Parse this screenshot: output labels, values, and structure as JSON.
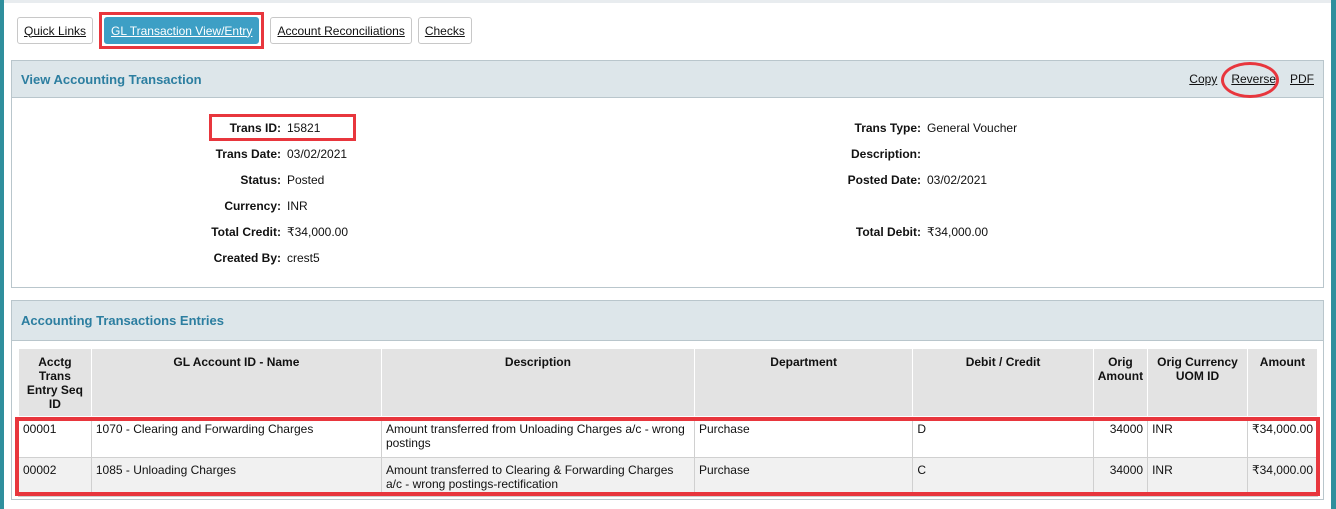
{
  "tabs": [
    {
      "label": "Quick Links"
    },
    {
      "label": "GL Transaction View/Entry"
    },
    {
      "label": "Account Reconciliations"
    },
    {
      "label": "Checks"
    }
  ],
  "view_panel": {
    "title": "View Accounting Transaction",
    "actions": {
      "copy": "Copy",
      "reverse": "Reverse",
      "pdf": "PDF"
    },
    "fields": {
      "trans_id": {
        "label": "Trans ID:",
        "value": "15821"
      },
      "trans_date": {
        "label": "Trans Date:",
        "value": "03/02/2021"
      },
      "status": {
        "label": "Status:",
        "value": "Posted"
      },
      "currency": {
        "label": "Currency:",
        "value": "INR"
      },
      "total_credit": {
        "label": "Total Credit:",
        "value": "₹34,000.00"
      },
      "created_by": {
        "label": "Created By:",
        "value": "crest5"
      },
      "trans_type": {
        "label": "Trans Type:",
        "value": "General Voucher"
      },
      "description": {
        "label": "Description:",
        "value": ""
      },
      "posted_date": {
        "label": "Posted Date:",
        "value": "03/02/2021"
      },
      "total_debit": {
        "label": "Total Debit:",
        "value": "₹34,000.00"
      }
    }
  },
  "entries_panel": {
    "title": "Accounting Transactions Entries",
    "columns": [
      "Acctg Trans Entry Seq ID",
      "GL Account ID - Name",
      "Description",
      "Department",
      "Debit / Credit",
      "Orig Amount",
      "Orig Currency UOM ID",
      "Amount"
    ],
    "rows": [
      {
        "seq": "00001",
        "account": "1070 - Clearing and Forwarding Charges",
        "description": "Amount transferred from Unloading Charges a/c - wrong postings",
        "department": "Purchase",
        "dc": "D",
        "orig_amount": "34000",
        "currency": "INR",
        "amount": "₹34,000.00"
      },
      {
        "seq": "00002",
        "account": "1085 - Unloading Charges",
        "description": "Amount transferred to Clearing & Forwarding Charges a/c - wrong postings-rectification",
        "department": "Purchase",
        "dc": "C",
        "orig_amount": "34000",
        "currency": "INR",
        "amount": "₹34,000.00"
      }
    ]
  },
  "colors": {
    "accent": "#3d9fc5",
    "highlight": "#e8363d",
    "header_bg": "#dde6ea",
    "title": "#2c7ea0"
  }
}
